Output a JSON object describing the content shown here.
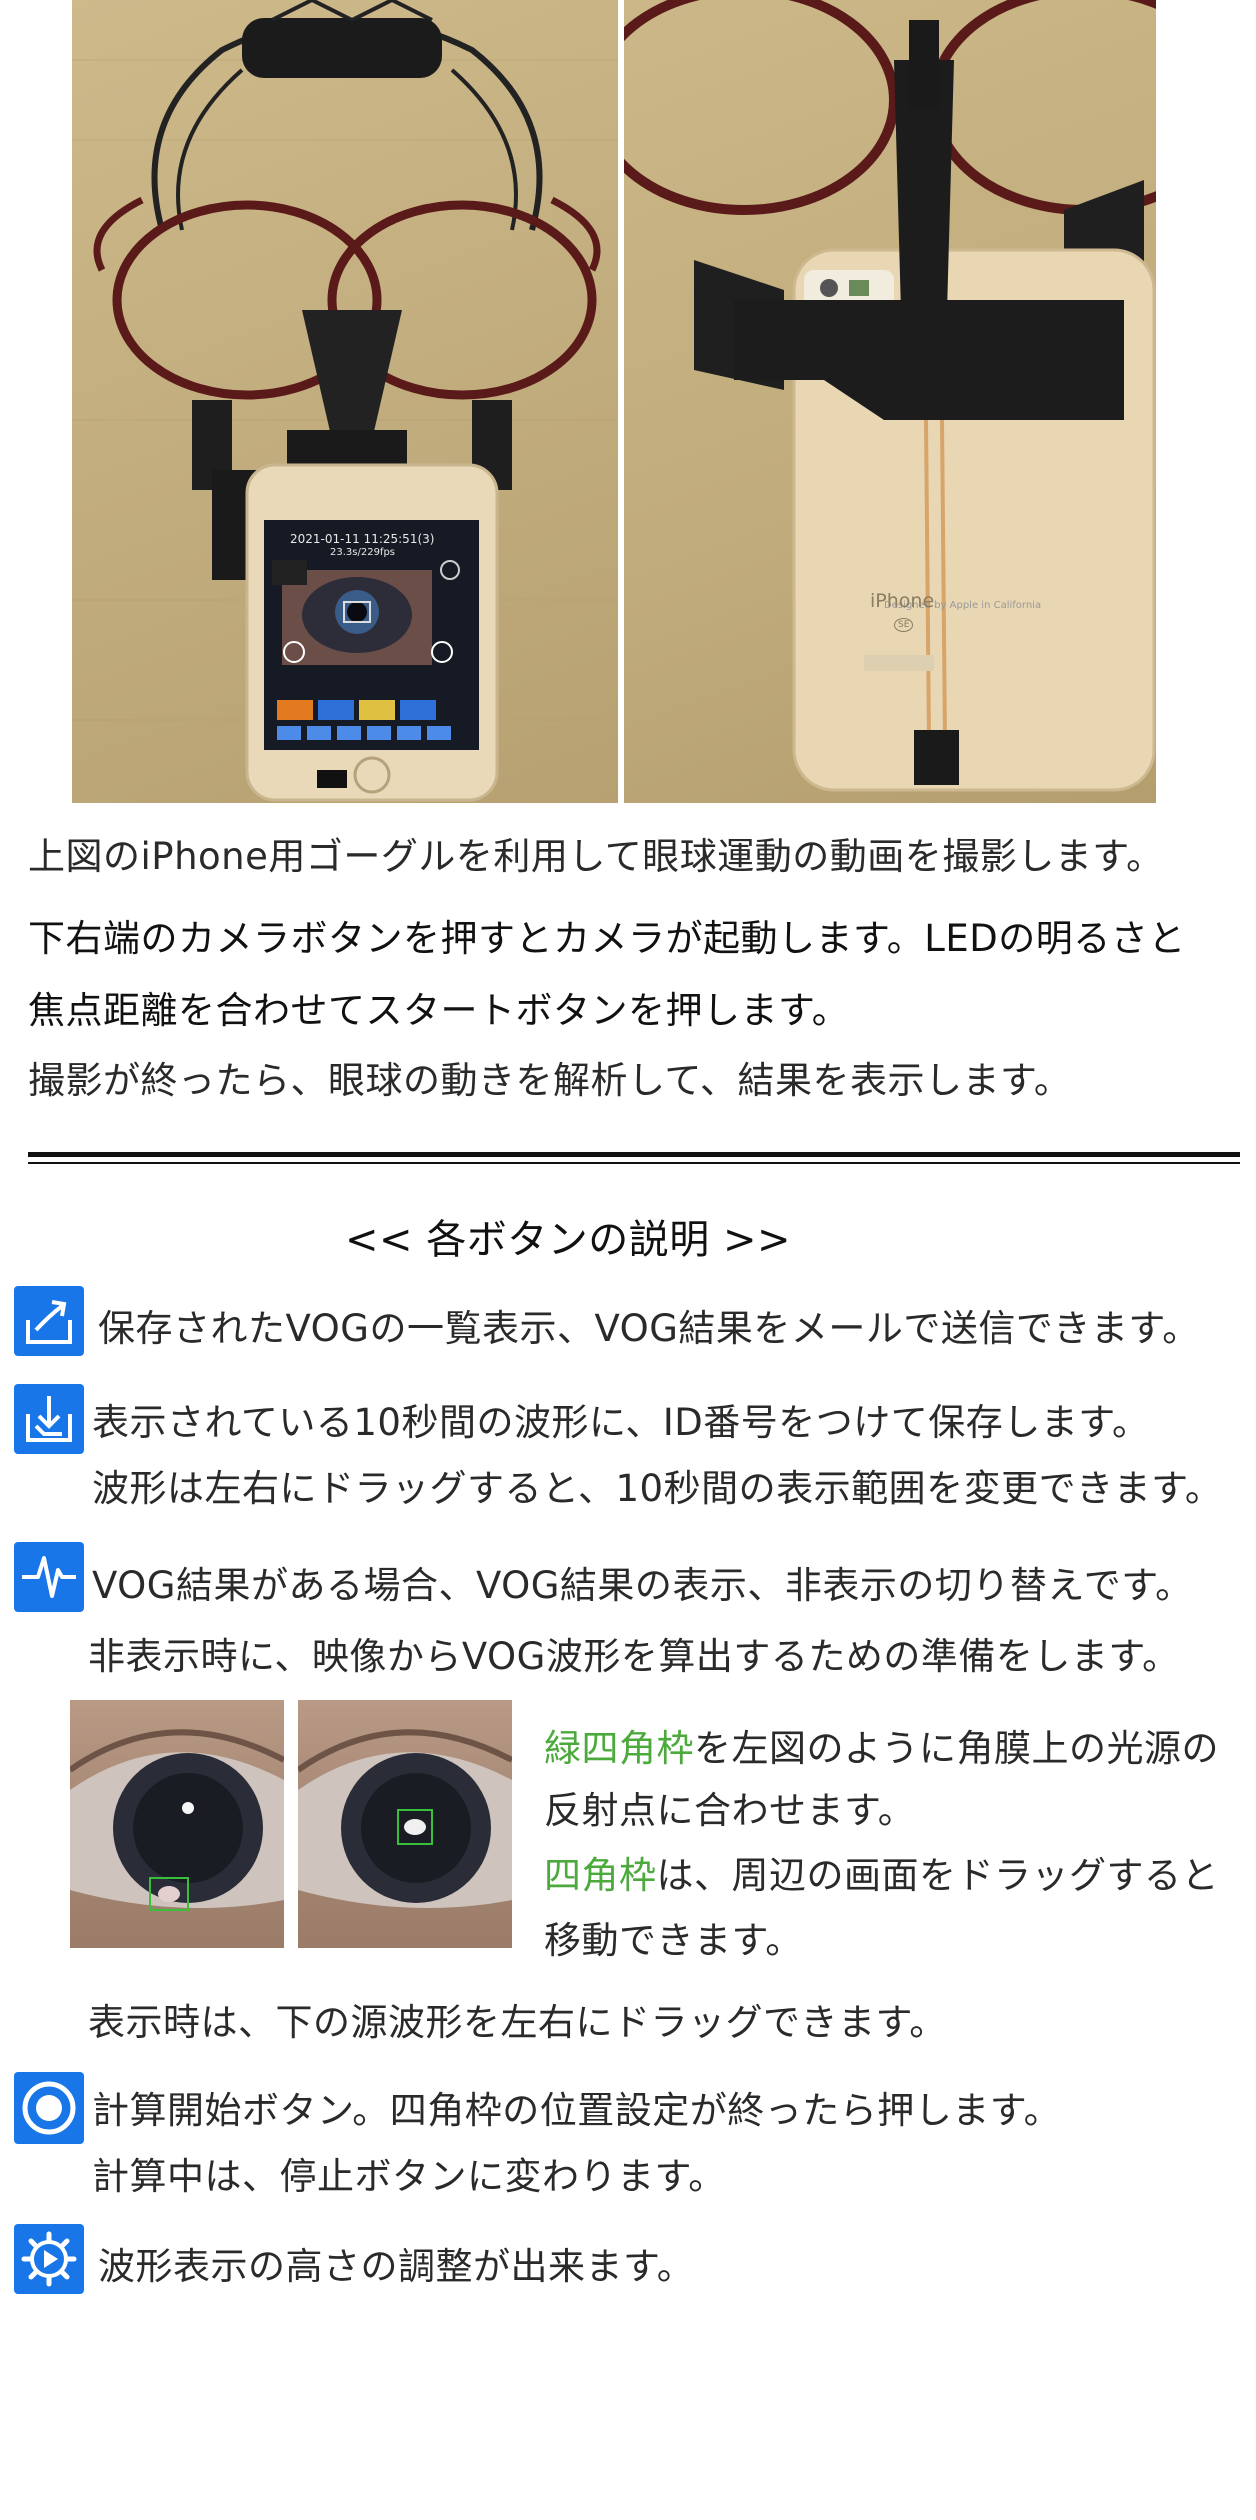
{
  "intro": {
    "line1": "上図のiPhone用ゴーグルを利用して眼球運動の動画を撮影します。",
    "line2": "下右端のカメラボタンを押すとカメラが起動します。LEDの明るさと",
    "line3": "焦点距離を合わせてスタートボタンを押します。",
    "line4": "撮影が終ったら、眼球の動きを解析して、結果を表示します。"
  },
  "phone_screen": {
    "timestamp": "2021-01-11 11:25:51(3)",
    "fps": "23.3s/229fps"
  },
  "phone_back": {
    "brand": "iPhone",
    "model": "SE"
  },
  "section_title": "<< 各ボタンの説明 >>",
  "buttons": {
    "export": {
      "icon": "share-export-icon",
      "text": "保存されたVOGの一覧表示、VOG結果をメールで送信できます。"
    },
    "save": {
      "icon": "save-download-icon",
      "text1": "表示されている10秒間の波形に、ID番号をつけて保存します。",
      "text2": "波形は左右にドラッグすると、10秒間の表示範囲を変更できます。"
    },
    "waveform": {
      "icon": "waveform-icon",
      "text1": "VOG結果がある場合、VOG結果の表示、非表示の切り替えです。",
      "text2": "非表示時に、映像からVOG波形を算出するための準備をします。"
    },
    "calc": {
      "icon": "record-circle-icon",
      "text1": "計算開始ボタン。四角枠の位置設定が終ったら押します。",
      "text2": "計算中は、停止ボタンに変わります。"
    },
    "settings": {
      "icon": "gear-play-icon",
      "text": "波形表示の高さの調整が出来ます。"
    }
  },
  "eye_note": {
    "green1": "緑四角枠",
    "rest1": "を左図のように角膜上の光源の",
    "line2": "反射点に合わせます。",
    "green2": "四角枠",
    "rest3": "は、周辺の画面をドラッグすると",
    "line4": "移動できます。",
    "display": "表示時は、下の源波形を左右にドラッグできます。"
  },
  "colors": {
    "accent_blue": "#1976e8",
    "green": "#4caa3c"
  }
}
